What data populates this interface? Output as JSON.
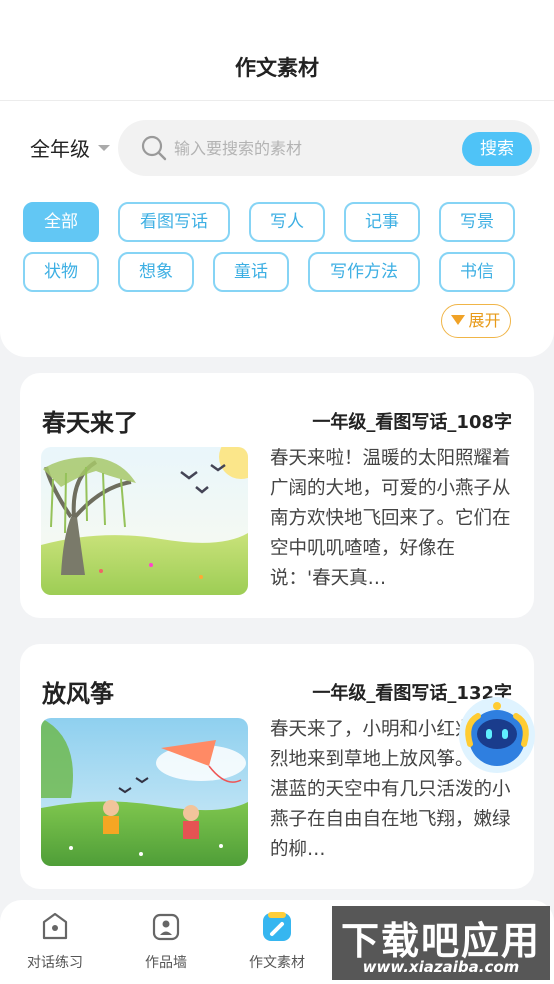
{
  "header": {
    "title": "作文素材"
  },
  "filters": {
    "grade": "全年级",
    "search_placeholder": "输入要搜索的素材",
    "search_button": "搜索",
    "categories": [
      "全部",
      "看图写话",
      "写人",
      "记事",
      "写景",
      "状物",
      "想象",
      "童话",
      "写作方法",
      "书信"
    ],
    "active_category": "全部",
    "expand_label": "展开"
  },
  "articles": [
    {
      "title": "春天来了",
      "meta": "一年级_看图写话_108字",
      "excerpt": "春天来啦！温暖的太阳照耀着广阔的大地，可爱的小燕子从南方欢快地飞回来了。它们在空中叽叽喳喳，好像在说：'春天真…"
    },
    {
      "title": "放风筝",
      "meta": "一年级_看图写话_132字",
      "excerpt": "春天来了，小明和小红兴高采烈地来到草地上放风筝。看，湛蓝的天空中有几只活泼的小燕子在自由自在地飞翔，嫩绿的柳…"
    }
  ],
  "tabs": [
    {
      "label": "对话练习",
      "icon": "chat-robot-icon"
    },
    {
      "label": "作品墙",
      "icon": "portrait-icon"
    },
    {
      "label": "作文素材",
      "icon": "pencil-note-icon",
      "active": true
    }
  ],
  "watermark": {
    "main": "下载吧应用",
    "url": "www.xiazaiba.com"
  },
  "colors": {
    "accent": "#62c7f4",
    "expand": "#f0a227",
    "chip_border": "#86d4f5"
  }
}
